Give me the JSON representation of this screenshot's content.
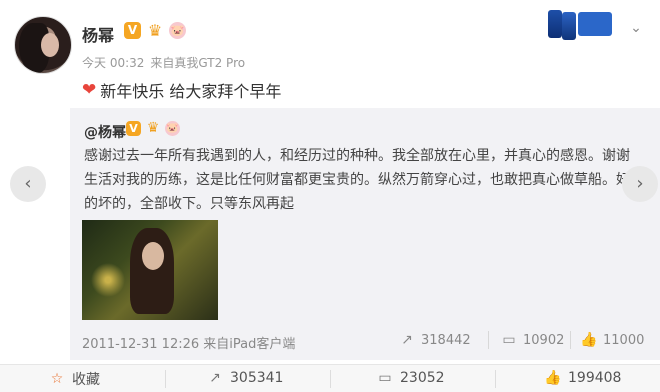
{
  "post": {
    "user_name": "杨幂",
    "meta": {
      "time": "今天 00:32",
      "source": "来自真我GT2 Pro"
    },
    "text": "新年快乐 给大家拜个早年",
    "heart_icon_color": "#e8453c"
  },
  "badges": {
    "verified": "V"
  },
  "repost": {
    "user_name": "@杨幂",
    "body": "感谢过去一年所有我遇到的人，和经历过的种种。我全部放在心里，并真心的感恩。谢谢生活对我的历练，这是比任何财富都更宝贵的。纵然万箭穿心过，也敢把真心做草船。好的坏的，全部收下。只等东风再起",
    "date": "2011-12-31 12:26",
    "source": "来自iPad客户端",
    "stats": {
      "reposts": "318442",
      "comments": "10902",
      "likes": "11000"
    }
  },
  "actions": {
    "favorite_label": "收藏",
    "reposts": "305341",
    "comments": "23052",
    "likes": "199408"
  },
  "colors": {
    "accent": "#f5a623",
    "favorite_icon": "#e86e2b"
  }
}
